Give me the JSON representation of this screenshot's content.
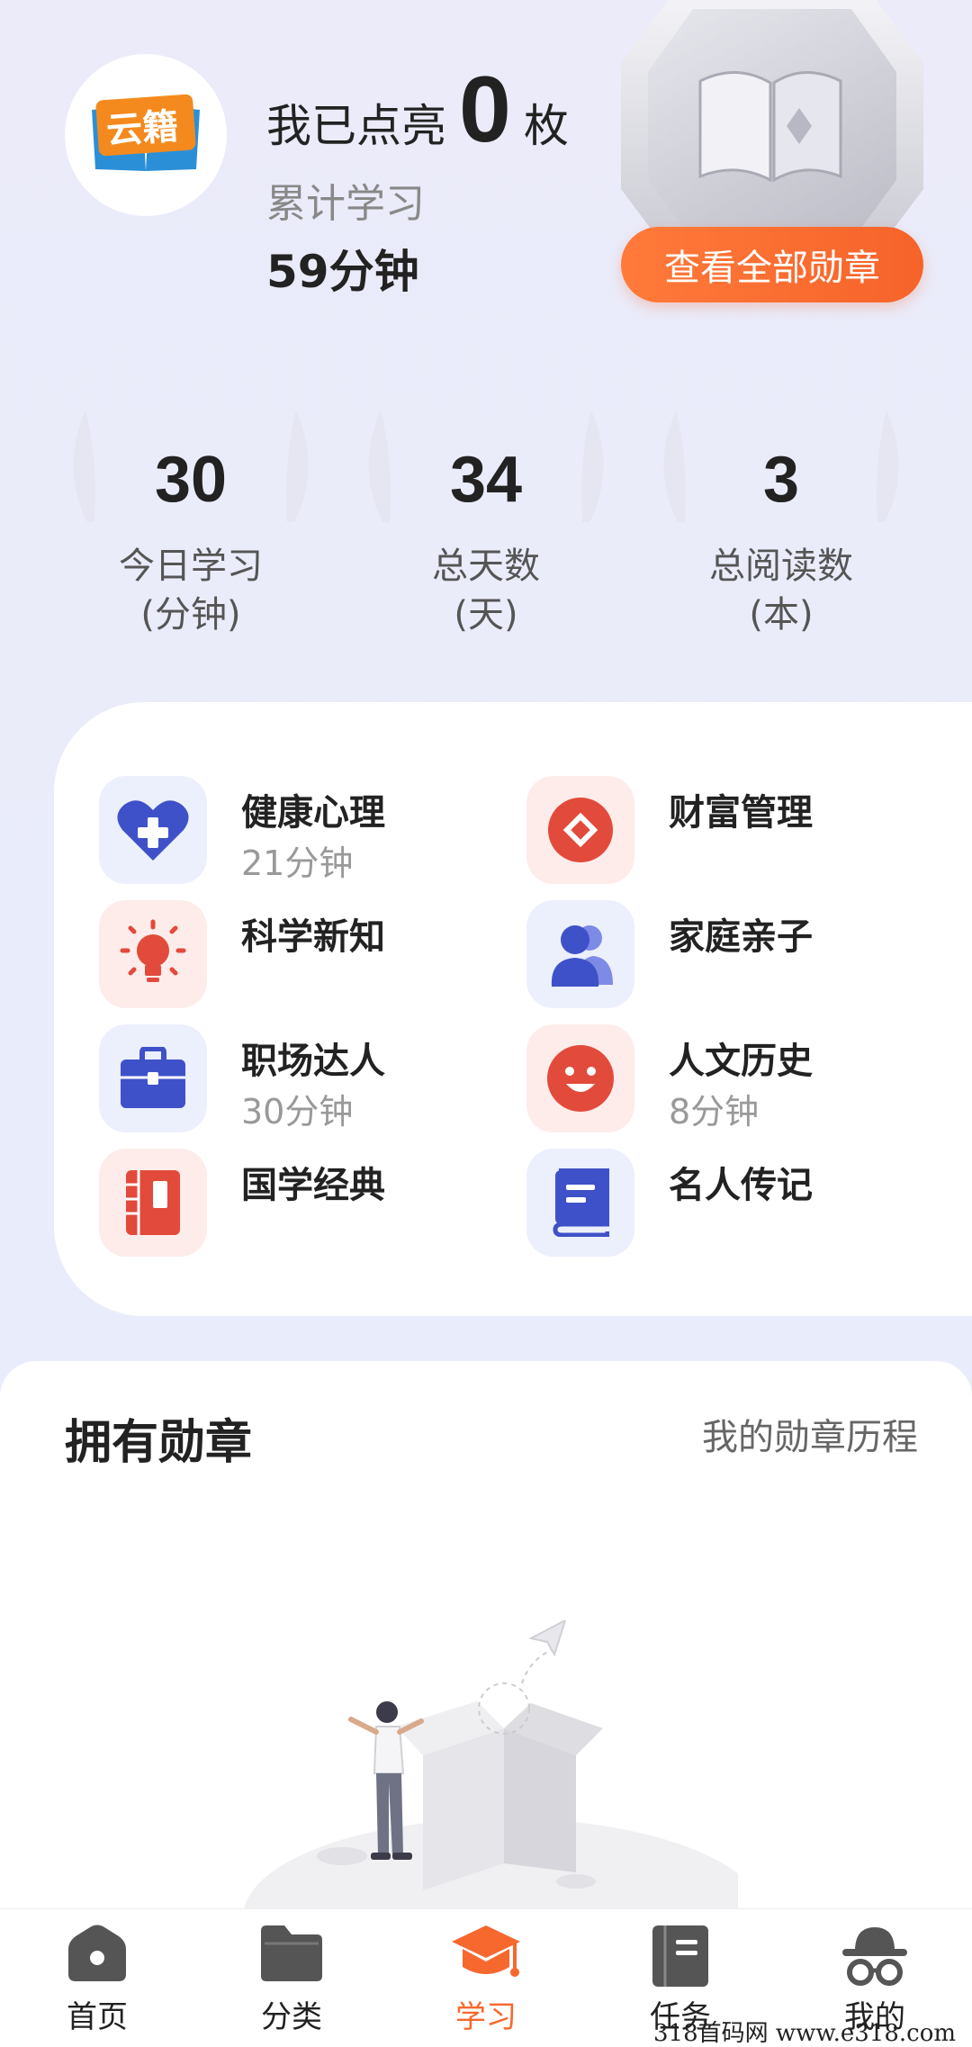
{
  "header": {
    "lit_prefix": "我已点亮",
    "lit_count": "0",
    "lit_suffix": "枚",
    "cumulative_label": "累计学习",
    "cumulative_value": "59分钟",
    "view_all_badges": "查看全部勋章"
  },
  "stats": [
    {
      "value": "30",
      "label": "今日学习",
      "unit": "(分钟)"
    },
    {
      "value": "34",
      "label": "总天数",
      "unit": "(天)"
    },
    {
      "value": "3",
      "label": "总阅读数",
      "unit": "(本)"
    }
  ],
  "categories": [
    {
      "title": "健康心理",
      "sub": "21分钟",
      "icon": "heart-plus-icon",
      "tone": "blue"
    },
    {
      "title": "财富管理",
      "sub": "",
      "icon": "coin-icon",
      "tone": "red"
    },
    {
      "title": "科学新知",
      "sub": "",
      "icon": "lightbulb-icon",
      "tone": "red"
    },
    {
      "title": "家庭亲子",
      "sub": "",
      "icon": "family-icon",
      "tone": "blue"
    },
    {
      "title": "职场达人",
      "sub": "30分钟",
      "icon": "briefcase-icon",
      "tone": "blue"
    },
    {
      "title": "人文历史",
      "sub": "8分钟",
      "icon": "smile-face-icon",
      "tone": "red"
    },
    {
      "title": "国学经典",
      "sub": "",
      "icon": "classic-book-icon",
      "tone": "red"
    },
    {
      "title": "名人传记",
      "sub": "",
      "icon": "biography-book-icon",
      "tone": "blue"
    }
  ],
  "badges": {
    "title": "拥有勋章",
    "history_link": "我的勋章历程"
  },
  "nav": [
    {
      "label": "首页",
      "icon": "home-icon"
    },
    {
      "label": "分类",
      "icon": "folder-icon"
    },
    {
      "label": "学习",
      "icon": "graduation-cap-icon",
      "active": true
    },
    {
      "label": "任务",
      "icon": "task-book-icon"
    },
    {
      "label": "我的",
      "icon": "profile-glasses-icon"
    }
  ],
  "colors": {
    "accent": "#f6682e",
    "blue_icon": "#3f51c8",
    "red_icon": "#e24a3b"
  },
  "watermark": "318首码网  www.e318.com"
}
